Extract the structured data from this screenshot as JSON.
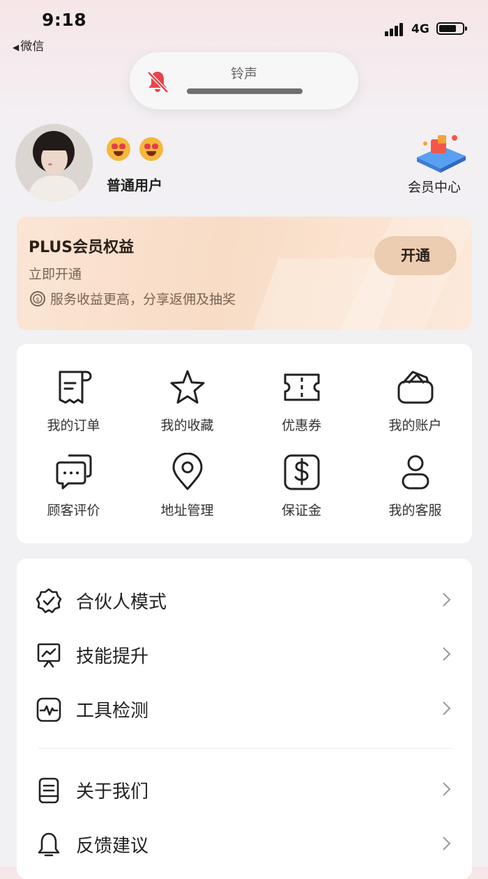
{
  "status_bar": {
    "time": "9:18",
    "back_app": "微信",
    "network": "4G",
    "back_arrow": "◀"
  },
  "ringer_overlay": {
    "label": "铃声",
    "icon": "bell-muted-icon"
  },
  "profile": {
    "username": "普通用户",
    "emojis": [
      "heart-eyes-emoji",
      "heart-eyes-emoji"
    ],
    "member_center_label": "会员中心"
  },
  "plus_card": {
    "title": "PLUS会员权益",
    "subtitle": "立即开通",
    "benefit": "服务收益更高，分享返佣及抽奖",
    "button": "开通"
  },
  "grid": [
    {
      "label": "我的订单",
      "icon": "receipt-icon"
    },
    {
      "label": "我的收藏",
      "icon": "star-icon"
    },
    {
      "label": "优惠券",
      "icon": "ticket-icon"
    },
    {
      "label": "我的账户",
      "icon": "wallet-icon"
    },
    {
      "label": "顾客评价",
      "icon": "chat-bubbles-icon"
    },
    {
      "label": "地址管理",
      "icon": "location-pin-icon"
    },
    {
      "label": "保证金",
      "icon": "dollar-icon"
    },
    {
      "label": "我的客服",
      "icon": "person-icon"
    }
  ],
  "menu": [
    {
      "label": "合伙人模式",
      "icon": "badge-check-icon"
    },
    {
      "label": "技能提升",
      "icon": "presentation-icon"
    },
    {
      "label": "工具检测",
      "icon": "pulse-monitor-icon"
    },
    {
      "label": "关于我们",
      "icon": "document-icon"
    },
    {
      "label": "反馈建议",
      "icon": "bell-icon"
    }
  ],
  "colors": {
    "plus_bg": "#f8dcc6",
    "plus_button": "#eccdb1",
    "muted_bell": "#e8444b"
  }
}
